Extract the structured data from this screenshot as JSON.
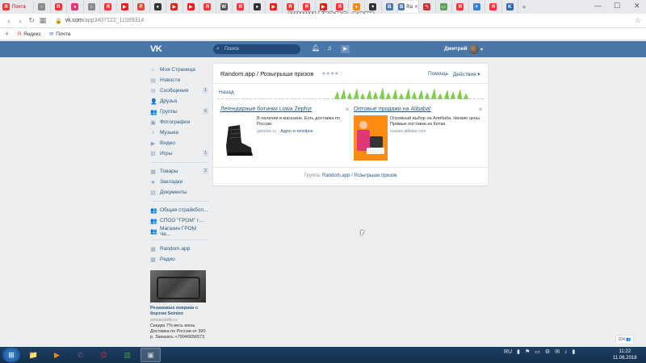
{
  "browser": {
    "first_tab_label": "Почта",
    "active_tab_label": "Ra",
    "tab_favicons": [
      {
        "glyph": "☆",
        "color": "#888888"
      },
      {
        "glyph": "Я",
        "color": "#ff3333"
      },
      {
        "glyph": "●",
        "color": "#e0367a"
      },
      {
        "glyph": "☆",
        "color": "#888888"
      },
      {
        "glyph": "Я",
        "color": "#ff3333"
      },
      {
        "glyph": "▶",
        "color": "#e62117"
      },
      {
        "glyph": "P",
        "color": "#e34a34"
      },
      {
        "glyph": "●",
        "color": "#333333"
      },
      {
        "glyph": "▶",
        "color": "#e62117"
      },
      {
        "glyph": "▶",
        "color": "#e62117"
      },
      {
        "glyph": "Я",
        "color": "#ff3333"
      },
      {
        "glyph": "W",
        "color": "#555555"
      },
      {
        "glyph": "Я",
        "color": "#ff3333"
      },
      {
        "glyph": "●",
        "color": "#333333"
      },
      {
        "glyph": "▶",
        "color": "#e62117"
      },
      {
        "glyph": "Я",
        "color": "#ff3333"
      },
      {
        "glyph": "Я",
        "color": "#ff3333"
      },
      {
        "glyph": "▶",
        "color": "#e62117"
      },
      {
        "glyph": "Я",
        "color": "#ff3333"
      },
      {
        "glyph": "●",
        "color": "#ff8a00"
      },
      {
        "glyph": "✦",
        "color": "#333333"
      },
      {
        "glyph": "В",
        "color": "#4a76a8"
      }
    ],
    "tab_favicons_after": [
      {
        "glyph": "✎",
        "color": "#cc3333"
      },
      {
        "glyph": "▭",
        "color": "#5aa05a"
      },
      {
        "glyph": "Я",
        "color": "#ff3333"
      },
      {
        "glyph": "✈",
        "color": "#3b7bd9"
      },
      {
        "glyph": "Я",
        "color": "#ff3333"
      },
      {
        "glyph": "K",
        "color": "#2a6ab8"
      }
    ],
    "watermark": "www.fraps.com",
    "url_host": "vk.com",
    "url_path": "/app3407122_11589314",
    "bookmarks": [
      {
        "icon": "Я",
        "label": "Яндекс"
      },
      {
        "icon": "✉",
        "label": "Почта"
      }
    ]
  },
  "vk": {
    "logo": "VK",
    "search_placeholder": "Поиск",
    "username": "Дмитрий",
    "menu": [
      {
        "icon": "⌂",
        "label": "Моя Страница",
        "count": ""
      },
      {
        "icon": "▤",
        "label": "Новости",
        "count": ""
      },
      {
        "icon": "✉",
        "label": "Сообщения",
        "count": "1"
      },
      {
        "icon": "👤",
        "label": "Друзья",
        "count": ""
      },
      {
        "icon": "👥",
        "label": "Группы",
        "count": "6"
      },
      {
        "icon": "▣",
        "label": "Фотографии",
        "count": ""
      },
      {
        "icon": "♪",
        "label": "Музыка",
        "count": ""
      },
      {
        "icon": "▶",
        "label": "Видео",
        "count": ""
      },
      {
        "icon": "⚄",
        "label": "Игры",
        "count": "1"
      }
    ],
    "menu2": [
      {
        "icon": "▦",
        "label": "Товары",
        "count": "2"
      },
      {
        "icon": "★",
        "label": "Закладки",
        "count": ""
      },
      {
        "icon": "▤",
        "label": "Документы",
        "count": ""
      }
    ],
    "menu3": [
      {
        "icon": "👥",
        "label": "Общая страйкбол..."
      },
      {
        "icon": "👥",
        "label": "СПОО \"ГРОМ\" г...."
      },
      {
        "icon": "👥",
        "label": "Магазин ГРОМ Че..."
      }
    ],
    "menu4": [
      {
        "icon": "▦",
        "label": "Random.app"
      },
      {
        "icon": "▦",
        "label": "Радио"
      }
    ],
    "side_ad": {
      "title": "Резиновые коврики с бортом Seintex",
      "domain": "avtolandshik.ru",
      "desc": "Скидка 7% весь июнь Доставка по России от 390 р. Заказать +79046656573"
    },
    "app": {
      "title": "Random.app / Розыгрыши призов",
      "stars": "★★★★☆",
      "help": "Помощь",
      "actions": "Действия ▾",
      "back": "Назад",
      "ads": [
        {
          "title": "Легендарные ботинки Lowa Zephyr",
          "text": "В наличии в магазине. Есть доставка по России.",
          "domain": "garrison.ru",
          "link": "Адрес и телефон"
        },
        {
          "title": "Оптовые продажи на Alibaba!",
          "text": "Огромный выбор на Алибаба. Низкие цены. Прямые поставки из Китая.",
          "domain": "russian.alibaba.com",
          "link": ""
        }
      ],
      "group_prefix": "Группа:",
      "group_link": "Random.app / Розыгрыши призов"
    },
    "chat_badge": "104 👥"
  },
  "taskbar": {
    "apps": [
      {
        "name": "explorer",
        "glyph": "📁",
        "color": "#e8c25a"
      },
      {
        "name": "media",
        "glyph": "▶",
        "color": "#f08b1a"
      },
      {
        "name": "viber",
        "glyph": "✆",
        "color": "#7b519d"
      },
      {
        "name": "opera",
        "glyph": "O",
        "color": "#ff1b2d"
      },
      {
        "name": "monitor",
        "glyph": "▥",
        "color": "#3c9c3c"
      },
      {
        "name": "fraps",
        "glyph": "▣",
        "color": "#c8c8c8"
      }
    ],
    "lang": "RU",
    "time": "11:22",
    "date": "11.06.2018"
  },
  "colors": {
    "vk_blue": "#4a76a8",
    "link": "#2a5885"
  }
}
